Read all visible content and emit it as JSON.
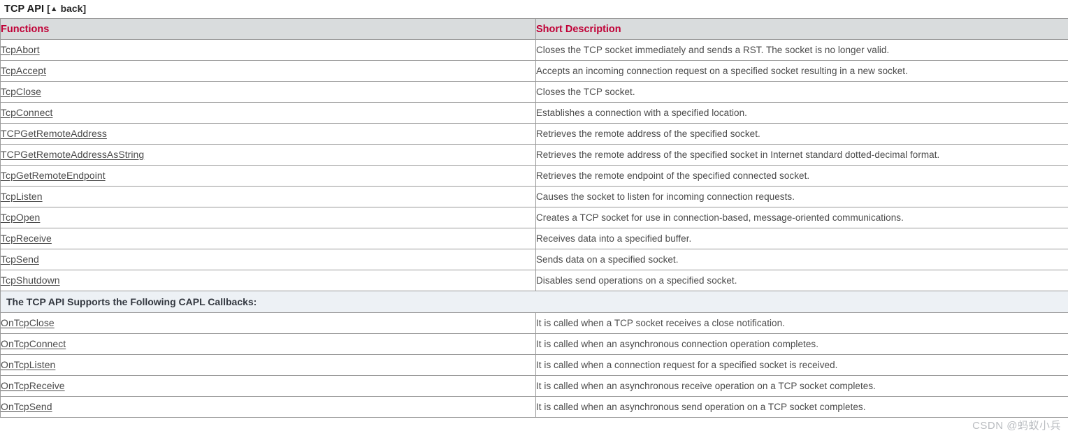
{
  "page": {
    "title": "TCP API",
    "back_label": "back",
    "back_bracket_open": "[",
    "back_bracket_close": "]",
    "back_arrow_icon": "up-triangle-icon"
  },
  "table": {
    "headers": {
      "functions": "Functions",
      "short_description": "Short Description"
    },
    "functions": [
      {
        "name": "TcpAbort",
        "description": "Closes the TCP socket immediately and sends a RST. The socket is no longer valid."
      },
      {
        "name": "TcpAccept",
        "description": "Accepts an incoming connection request on a specified socket resulting in a new socket."
      },
      {
        "name": "TcpClose",
        "description": "Closes the TCP socket."
      },
      {
        "name": "TcpConnect",
        "description": "Establishes a connection with a specified location."
      },
      {
        "name": "TCPGetRemoteAddress",
        "description": "Retrieves the remote address of the specified socket."
      },
      {
        "name": "TCPGetRemoteAddressAsString",
        "description": "Retrieves the remote address of the specified socket in Internet standard dotted-decimal format."
      },
      {
        "name": "TcpGetRemoteEndpoint",
        "description": "Retrieves the remote endpoint of the specified connected socket."
      },
      {
        "name": "TcpListen",
        "description": "Causes the socket to listen for incoming connection requests."
      },
      {
        "name": "TcpOpen",
        "description": "Creates a TCP socket for use in connection-based, message-oriented communications."
      },
      {
        "name": "TcpReceive",
        "description": "Receives data into a specified buffer."
      },
      {
        "name": "TcpSend",
        "description": "Sends data on a specified socket."
      },
      {
        "name": "TcpShutdown",
        "description": "Disables send operations on a specified socket."
      }
    ],
    "callbacks_section_title": "The TCP API Supports the Following CAPL Callbacks:",
    "callbacks": [
      {
        "name": "OnTcpClose",
        "description": "It is called when a TCP socket receives a close notification."
      },
      {
        "name": "OnTcpConnect",
        "description": "It is called when an asynchronous connection operation completes."
      },
      {
        "name": "OnTcpListen",
        "description": "It is called when a connection request for a specified socket is received."
      },
      {
        "name": "OnTcpReceive",
        "description": "It is called when an asynchronous receive operation on a TCP socket completes."
      },
      {
        "name": "OnTcpSend",
        "description": "It is called when an asynchronous send operation on a TCP socket completes."
      }
    ]
  },
  "watermark": {
    "text": "CSDN @蚂蚁小兵"
  },
  "colors": {
    "header_accent": "#c00036",
    "header_bg": "#d9dcdd",
    "section_bg": "#edf1f5",
    "border": "#9a9a9a",
    "link": "#4a4a4a",
    "body_text": "#4b4b4b",
    "watermark": "#b9bcc0"
  }
}
